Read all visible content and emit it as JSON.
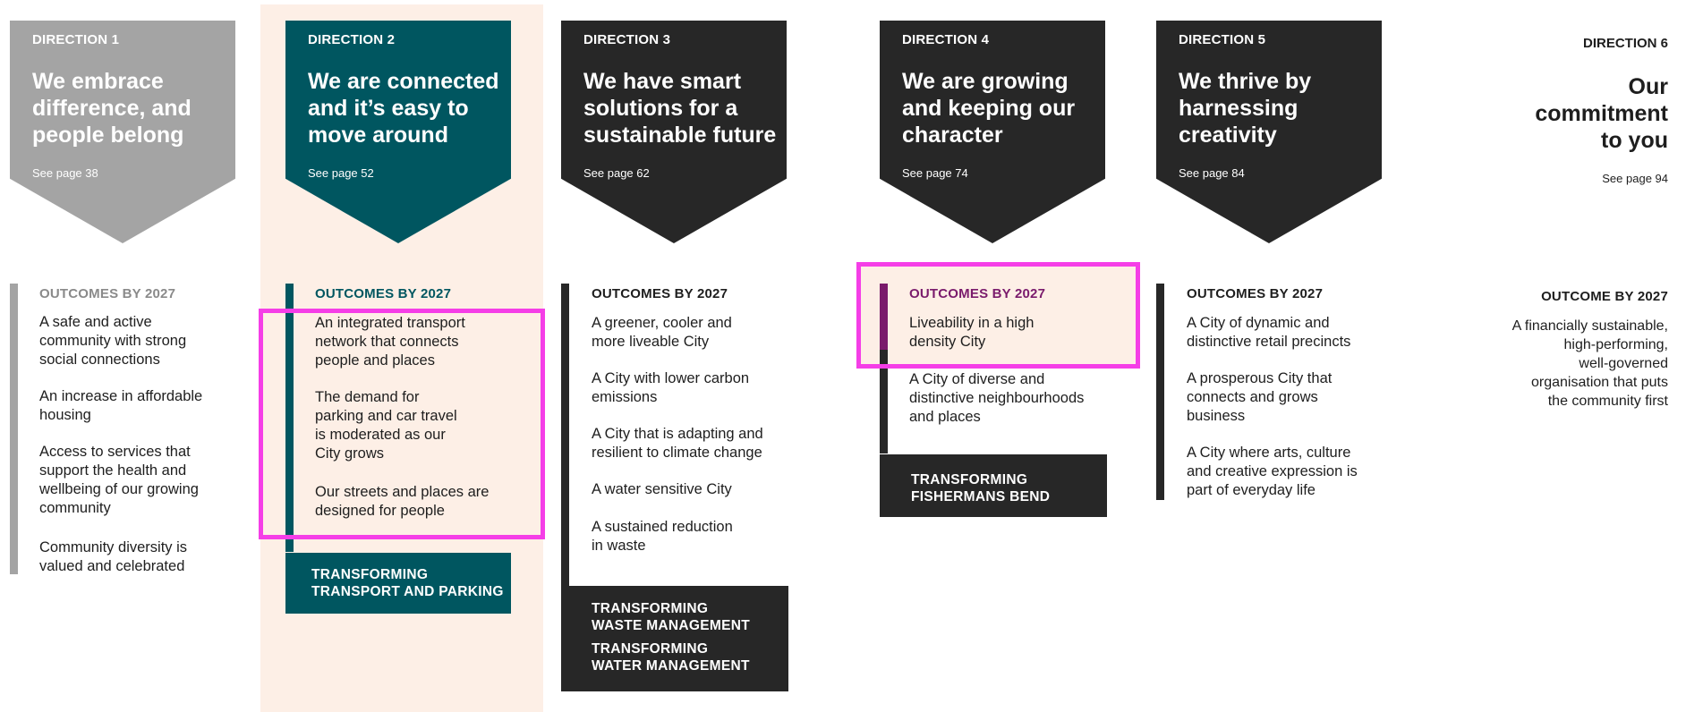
{
  "directions": [
    {
      "label": "DIRECTION 1",
      "title_lines": [
        "We embrace",
        "difference, and",
        "people belong"
      ],
      "see_page": "See page 38",
      "outcomes_title": "OUTCOMES BY 2027",
      "outcomes": [
        [
          "A safe and active",
          "community with strong",
          "social connections"
        ],
        [
          "An increase in affordable",
          "housing"
        ],
        [
          "Access to services that",
          "support the health and",
          "wellbeing of our growing",
          "community"
        ],
        [
          "Community diversity is",
          "valued and celebrated"
        ]
      ]
    },
    {
      "label": "DIRECTION 2",
      "title_lines": [
        "We are connected",
        "and it’s easy to",
        "move around"
      ],
      "see_page": "See page 52",
      "outcomes_title": "OUTCOMES BY 2027",
      "outcomes": [
        [
          "An integrated transport",
          "network that connects",
          "people and places"
        ],
        [
          "The demand for",
          "parking and car travel",
          "is moderated as our",
          "City grows"
        ],
        [
          "Our streets and places are",
          "designed for people"
        ]
      ],
      "transforming": [
        [
          "TRANSFORMING",
          "TRANSPORT AND PARKING"
        ]
      ]
    },
    {
      "label": "DIRECTION 3",
      "title_lines": [
        "We have smart",
        "solutions for a",
        "sustainable future"
      ],
      "see_page": "See page 62",
      "outcomes_title": "OUTCOMES BY 2027",
      "outcomes": [
        [
          "A greener, cooler and",
          "more liveable City"
        ],
        [
          "A City with lower carbon",
          "emissions"
        ],
        [
          "A City that is adapting and",
          "resilient to climate change"
        ],
        [
          "A water sensitive City"
        ],
        [
          "A sustained reduction",
          "in waste"
        ]
      ],
      "transforming": [
        [
          "TRANSFORMING",
          "WASTE MANAGEMENT"
        ],
        [
          "TRANSFORMING",
          "WATER MANAGEMENT"
        ]
      ]
    },
    {
      "label": "DIRECTION 4",
      "title_lines": [
        "We are growing",
        "and keeping our",
        "character"
      ],
      "see_page": "See page 74",
      "outcomes_title": "OUTCOMES BY 2027",
      "outcomes": [
        [
          "Liveability in a high",
          "density City"
        ],
        [
          "A City of diverse and",
          "distinctive neighbourhoods",
          "and places"
        ]
      ],
      "transforming": [
        [
          "TRANSFORMING",
          "FISHERMANS BEND"
        ]
      ]
    },
    {
      "label": "DIRECTION 5",
      "title_lines": [
        "We thrive by",
        "harnessing",
        "creativity"
      ],
      "see_page": "See page 84",
      "outcomes_title": "OUTCOMES BY 2027",
      "outcomes": [
        [
          "A City of dynamic and",
          "distinctive retail precincts"
        ],
        [
          "A prosperous City that",
          "connects and grows",
          "business"
        ],
        [
          "A City where arts, culture",
          "and creative expression is",
          "part of everyday life"
        ]
      ]
    },
    {
      "label": "DIRECTION 6",
      "title_lines": [
        "Our",
        "commitment",
        "to you"
      ],
      "see_page": "See page 94",
      "outcomes_title": "OUTCOME BY 2027",
      "outcomes": [
        [
          "A financially sustainable,",
          "high-performing,",
          "well-governed",
          "organisation that puts",
          "the community first"
        ]
      ]
    }
  ],
  "colors": {
    "direction1": "#a4a4a4",
    "direction2": "#005660",
    "direction3": "#272727",
    "direction4": "#272727",
    "direction5": "#272727",
    "highlight": "#f53ee7",
    "d4_outcome_title": "#7a1b6c",
    "peach": "#fdefe6"
  }
}
